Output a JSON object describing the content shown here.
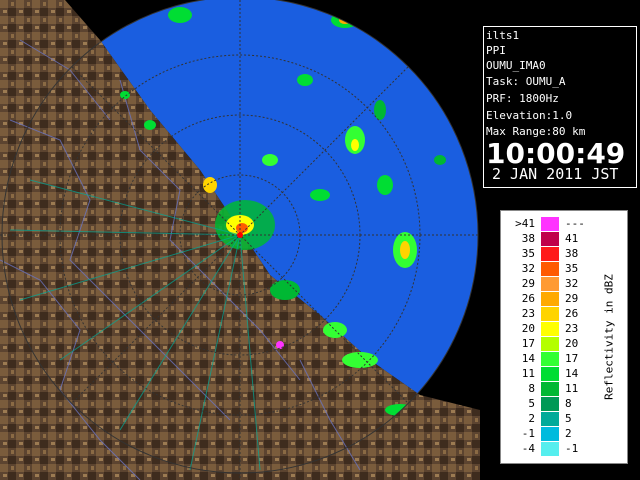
{
  "info": {
    "lines": [
      "ilts1",
      "PPI",
      "OUMU_IMA0",
      "Task: OUMU_A",
      "PRF: 1800Hz",
      "Elevation:1.0",
      "Max Range:80 km"
    ],
    "time": "10:00:49",
    "date": "2 JAN 2011 JST"
  },
  "legend": {
    "title": "Reflectivity in dBZ",
    "rows": [
      {
        "low": ">41",
        "high": "---",
        "color": "#ff33ff"
      },
      {
        "low": "38",
        "high": "41",
        "color": "#c0004a"
      },
      {
        "low": "35",
        "high": "38",
        "color": "#ff1a1a"
      },
      {
        "low": "32",
        "high": "35",
        "color": "#ff5a00"
      },
      {
        "low": "29",
        "high": "32",
        "color": "#ff9a33"
      },
      {
        "low": "26",
        "high": "29",
        "color": "#ffaa00"
      },
      {
        "low": "23",
        "high": "26",
        "color": "#ffd400"
      },
      {
        "low": "20",
        "high": "23",
        "color": "#ffff00"
      },
      {
        "low": "17",
        "high": "20",
        "color": "#b4ff00"
      },
      {
        "low": "14",
        "high": "17",
        "color": "#33ff33"
      },
      {
        "low": "11",
        "high": "14",
        "color": "#00dd33"
      },
      {
        "low": "8",
        "high": "11",
        "color": "#00b833"
      },
      {
        "low": "5",
        "high": "8",
        "color": "#009955"
      },
      {
        "low": "2",
        "high": "5",
        "color": "#00aa99"
      },
      {
        "low": "-1",
        "high": "2",
        "color": "#00bbdd"
      },
      {
        "low": "-4",
        "high": "-1",
        "color": "#55eeee"
      }
    ]
  },
  "colors": {
    "background": "#000000",
    "radar_disc": "#1a5ee0",
    "terrain_dark": "#4a3524",
    "terrain_light": "#9c7b52",
    "range_rings": "#333333"
  }
}
